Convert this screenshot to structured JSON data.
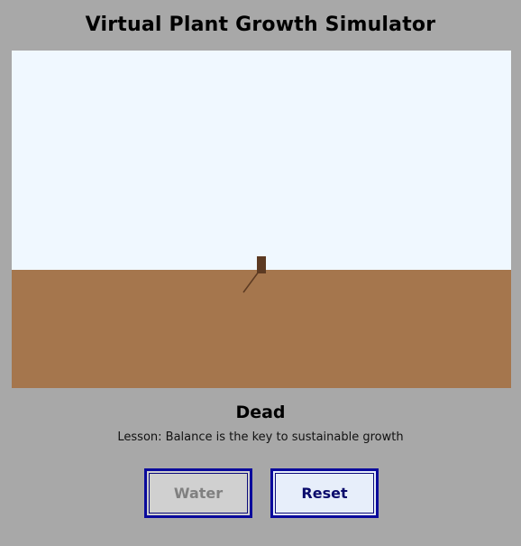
{
  "app": {
    "title": "Virtual Plant Growth Simulator"
  },
  "scene": {
    "sky_color": "#f0f8ff",
    "soil_color": "#a5764d",
    "stump_color": "#5c3a22"
  },
  "status": {
    "label": "Dead",
    "lesson": "Lesson: Balance is the key to sustainable growth"
  },
  "controls": {
    "water_label": "Water",
    "water_enabled": false,
    "reset_label": "Reset",
    "reset_enabled": true
  }
}
